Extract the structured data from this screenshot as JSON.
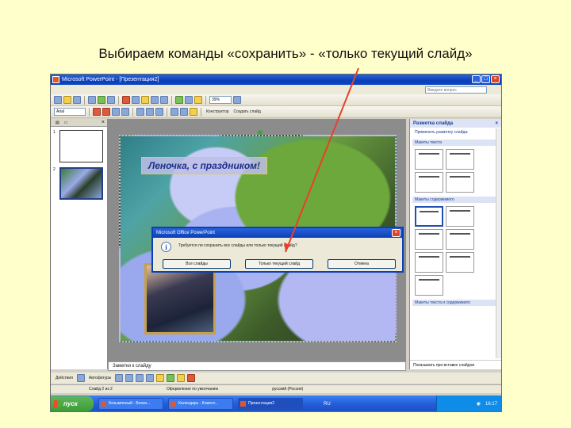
{
  "page": {
    "title": "Выбираем команды «сохранить» - «только текущий слайд»"
  },
  "window": {
    "title": "Microsoft PowerPoint - [Презентация2]",
    "help_placeholder": "Введите вопрос",
    "zoom": "39%",
    "font": "Arial"
  },
  "slide": {
    "caption": "Леночка, с праздником!"
  },
  "left_pane": {
    "slide_numbers": [
      "1",
      "2"
    ]
  },
  "notes": {
    "placeholder": "Заметки к слайду"
  },
  "task_pane": {
    "title": "Разметка слайда",
    "apply_link": "Применить разметку слайда:",
    "sections": [
      "Макеты текста",
      "Макеты содержимого",
      "Макеты текста и содержимого"
    ],
    "footer_checkbox": "Показывать при вставке слайдов"
  },
  "toolbar2": {
    "designer_label": "Конструктор",
    "new_slide_label": "Создать слайд"
  },
  "drawbar": {
    "actions_label": "Действия",
    "autoshapes_label": "Автофигуры"
  },
  "status": {
    "slide": "Слайд 2 из 2",
    "design": "Оформление по умолчанию",
    "language": "русский (Россия)"
  },
  "taskbar": {
    "start": "пуск",
    "tasks": [
      "Безымянный - Блокн...",
      "Календарь - Клиент...",
      "Презентация2"
    ],
    "lang": "RU",
    "clock": "16:17"
  },
  "dialog": {
    "title": "Microsoft Office PowerPoint",
    "message": "Требуется ли сохранить все слайды или только текущий слайд?",
    "button_all": "Все слайды",
    "button_current": "Только текущий слайд",
    "button_cancel": "Отмена"
  },
  "colors": {
    "page_bg": "#ffffcc",
    "pointer": "#e8402a",
    "caption_text": "#1f2f8a"
  }
}
